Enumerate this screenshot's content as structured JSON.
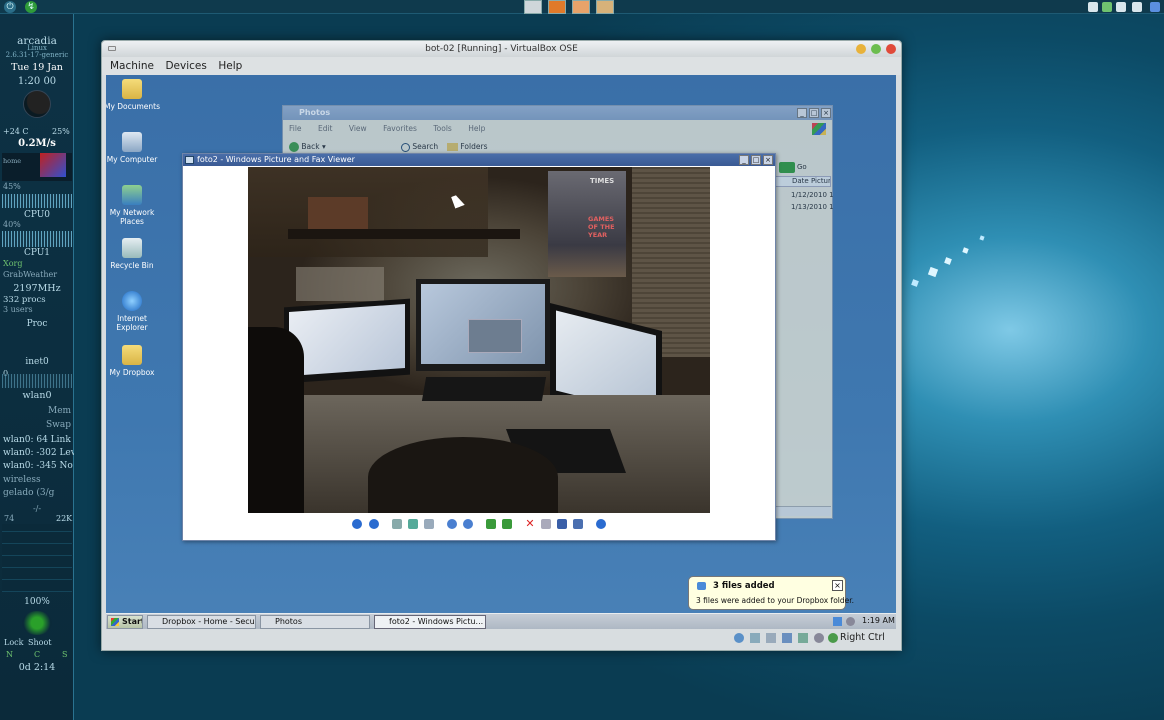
{
  "host": {
    "conky": {
      "hostname": "arcadia",
      "distro": "Linux",
      "kernel": "2.6.31-17-generic",
      "date": "Tue 19 Jan",
      "time": "1:20 00",
      "temp": "+24 C",
      "cpu_pct": "25%",
      "net_speed": "0.2M/s",
      "home_label": "home",
      "disk_pct": "45%",
      "cpu0_label": "CPU0",
      "cpu0_pct": "40%",
      "cpu1_label": "CPU1",
      "xorg": "Xorg",
      "grabweather": "GrabWeather",
      "mhz": "2197MHz",
      "procs": "332 procs",
      "users": "3 users",
      "proc_label": "Proc",
      "inet0": "inet0",
      "inet_val": "0",
      "wlan0": "wlan0",
      "mem_label": "Mem",
      "swap_label": "Swap",
      "link": "wlan0: 64 Link",
      "level": "wlan0: -302 Lev",
      "noise": "wlan0: -345 No",
      "wireless": "wireless",
      "weather": "gelado (3/g",
      "dash": "-/-",
      "rate": "22K",
      "rate_left": "74",
      "battery": "100%",
      "lock": "Lock",
      "shoot": "Shoot",
      "keys": [
        "N",
        "C",
        "S"
      ],
      "uptime": "0d 2:14"
    }
  },
  "vbox": {
    "title": "bot-02 [Running] - VirtualBox OSE",
    "menu": [
      "Machine",
      "Devices",
      "Help"
    ],
    "host_key": "Right Ctrl"
  },
  "guest": {
    "desktop_icons": [
      {
        "label": "My Documents",
        "icon": "folder-documents-icon"
      },
      {
        "label": "My Computer",
        "icon": "computer-icon"
      },
      {
        "label": "My Network Places",
        "icon": "network-icon"
      },
      {
        "label": "Recycle Bin",
        "icon": "recycle-bin-icon"
      },
      {
        "label": "Internet Explorer",
        "icon": "ie-icon"
      },
      {
        "label": "My Dropbox",
        "icon": "dropbox-folder-icon"
      }
    ],
    "explorer": {
      "title": "Photos",
      "menu": [
        "File",
        "Edit",
        "View",
        "Favorites",
        "Tools",
        "Help"
      ],
      "back": "Back",
      "search": "Search",
      "folders": "Folders",
      "go": "Go",
      "column": "Date Picture",
      "dates": [
        "1/12/2010 1",
        "1/13/2010 1"
      ]
    },
    "viewer": {
      "title": "foto2 - Windows Picture and Fax Viewer",
      "poster": "GAMES OF THE YEAR",
      "poster_top": "TIMES"
    },
    "balloon": {
      "title": "3 files added",
      "body": "3 files were added to your Dropbox folder."
    },
    "taskbar": {
      "start": "Start",
      "tasks": [
        "Dropbox - Home - Secur...",
        "Photos",
        "foto2 - Windows Pictu..."
      ],
      "clock": "1:19 AM"
    }
  }
}
